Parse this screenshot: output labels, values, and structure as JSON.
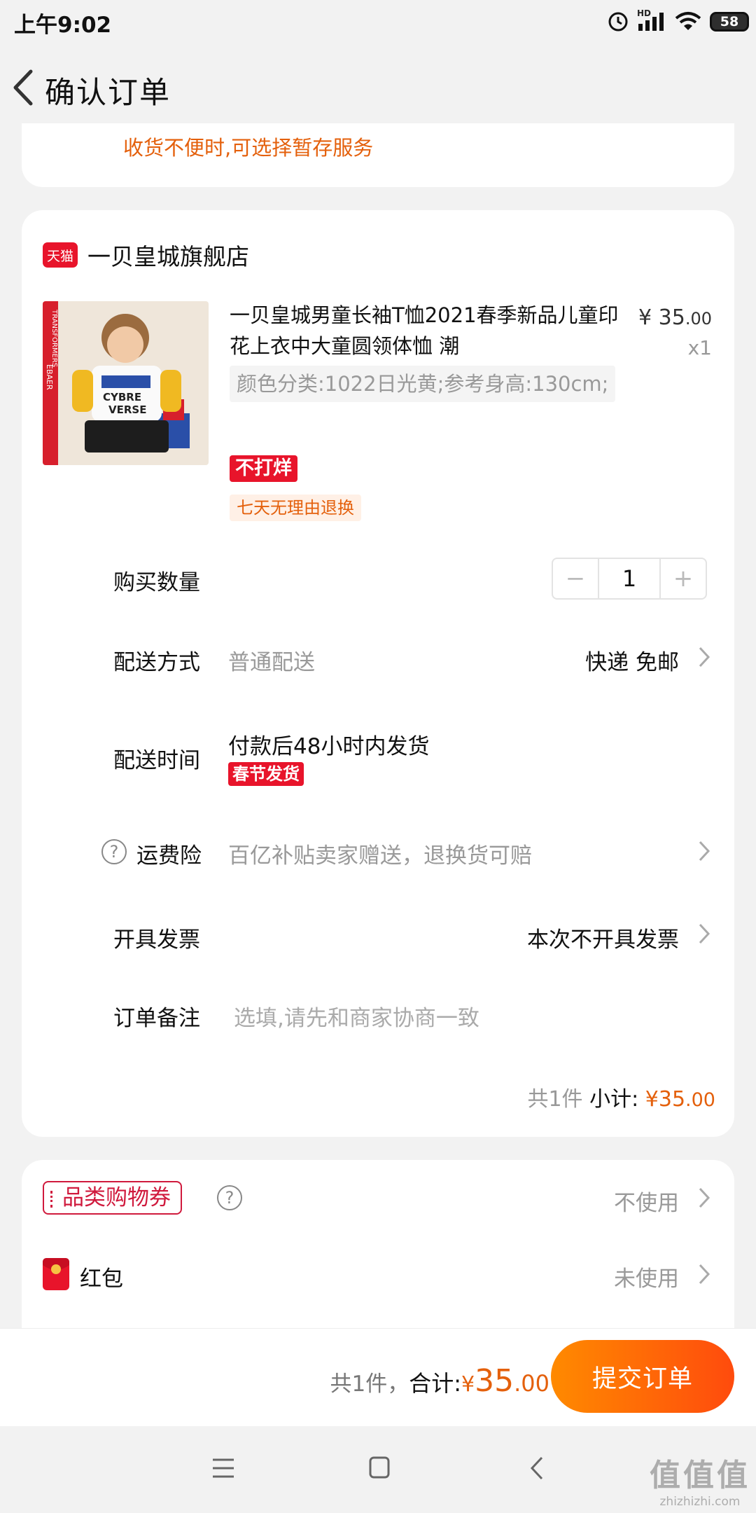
{
  "status_bar": {
    "time": "上午9:02",
    "battery": "58",
    "network": "HD"
  },
  "header": {
    "title": "确认订单"
  },
  "hint": "收货不便时,可选择暂存服务",
  "shop": {
    "badge": "天猫",
    "name": "一贝皇城旗舰店"
  },
  "product": {
    "title": "一贝皇城男童长袖T恤2021春季新品儿童印花上衣中大童圆领体恤 潮",
    "price_symbol": "¥",
    "price_int": "35",
    "price_cents": ".00",
    "quantity_label": "x1",
    "sku": "颜色分类:1022日光黄;参考身高:130cm;",
    "tag_no_haggle": "不打烊",
    "tag_return": "七天无理由退换",
    "image_brand": "TRANSFORMERS",
    "image_brand2": "EBAER"
  },
  "rows": {
    "quantity": {
      "label": "购买数量",
      "minus": "−",
      "value": "1",
      "plus": "+"
    },
    "delivery": {
      "label": "配送方式",
      "value": "普通配送",
      "right": "快递 免邮"
    },
    "ship_time": {
      "label": "配送时间",
      "value": "付款后48小时内发货",
      "tag": "春节发货"
    },
    "insurance": {
      "label": "运费险",
      "help": "?",
      "value": "百亿补贴卖家赠送，退换货可赔"
    },
    "invoice": {
      "label": "开具发票",
      "value": "本次不开具发票"
    },
    "note": {
      "label": "订单备注",
      "placeholder": "选填,请先和商家协商一致"
    }
  },
  "subtotal": {
    "count": "共1件",
    "label": "小计:",
    "symbol": "¥",
    "int": "35",
    "cents": ".00"
  },
  "coupon": {
    "label": "品类购物券",
    "help": "?",
    "value": "不使用"
  },
  "red_packet": {
    "label": "红包",
    "value": "未使用"
  },
  "bottom": {
    "count": "共1件，",
    "total_label": "合计:",
    "symbol": "¥",
    "int": "35",
    "cents": ".00",
    "submit": "提交订单"
  },
  "watermark": {
    "big": "值值值",
    "small": "zhizhizhi.com"
  },
  "colors": {
    "accent": "#e4600c",
    "tmall_red": "#e8142b",
    "submit_start": "#ff8a00",
    "submit_end": "#ff4b0d"
  }
}
